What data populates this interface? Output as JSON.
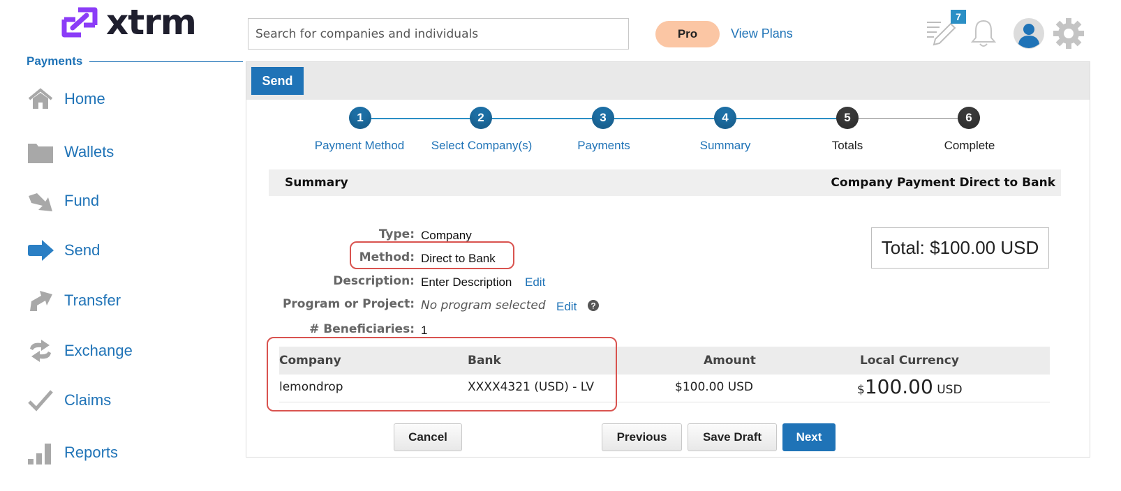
{
  "brand": {
    "name": "xtrm",
    "accent": "#1f73b7",
    "logo_color": "#8b3cf7"
  },
  "sidebar": {
    "section_title": "Payments",
    "items": [
      {
        "label": "Home",
        "icon": "home-icon"
      },
      {
        "label": "Wallets",
        "icon": "folder-icon"
      },
      {
        "label": "Fund",
        "icon": "fund-arrow-icon"
      },
      {
        "label": "Send",
        "icon": "send-arrow-icon"
      },
      {
        "label": "Transfer",
        "icon": "transfer-arrow-icon"
      },
      {
        "label": "Exchange",
        "icon": "exchange-icon"
      },
      {
        "label": "Claims",
        "icon": "checkmark-icon"
      },
      {
        "label": "Reports",
        "icon": "bar-chart-icon"
      }
    ]
  },
  "topbar": {
    "search_placeholder": "Search for companies and individuals",
    "plan_badge": "Pro",
    "view_plans": "View Plans",
    "notification_count": "7"
  },
  "panel": {
    "tab_label": "Send",
    "steps": [
      {
        "number": "1",
        "label": "Payment Method",
        "state": "done"
      },
      {
        "number": "2",
        "label": "Select Company(s)",
        "state": "done"
      },
      {
        "number": "3",
        "label": "Payments",
        "state": "done"
      },
      {
        "number": "4",
        "label": "Summary",
        "state": "done"
      },
      {
        "number": "5",
        "label": "Totals",
        "state": "todo"
      },
      {
        "number": "6",
        "label": "Complete",
        "state": "todo"
      }
    ],
    "summary_title": "Summary",
    "summary_subtitle": "Company Payment Direct to Bank",
    "details": {
      "type_label": "Type:",
      "type_value": "Company",
      "method_label": "Method:",
      "method_value": "Direct to Bank",
      "description_label": "Description:",
      "description_value": "Enter Description",
      "program_label": "Program or Project:",
      "program_value": "No program selected",
      "beneficiaries_label": "# Beneficiaries:",
      "beneficiaries_value": "1",
      "edit": "Edit"
    },
    "total": "Total: $100.00 USD",
    "table": {
      "headers": [
        "Company",
        "Bank",
        "Amount",
        "Local Currency"
      ],
      "rows": [
        {
          "company": "lemondrop",
          "bank": "XXXX4321 (USD) - LV",
          "amount": "$100.00 USD",
          "local_symbol": "$",
          "local_amount": "100.00",
          "local_code": "USD"
        }
      ]
    },
    "buttons": {
      "cancel": "Cancel",
      "previous": "Previous",
      "save_draft": "Save Draft",
      "next": "Next"
    }
  }
}
